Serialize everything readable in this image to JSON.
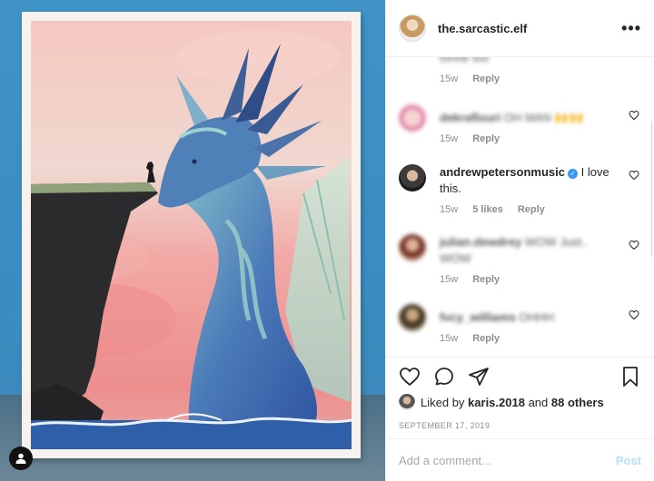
{
  "post": {
    "username": "the.sarcastic.elf",
    "more_label": "•••"
  },
  "comments": [
    {
      "user": "",
      "text": "fonne too",
      "age": "15w",
      "reply": "Reply",
      "blurred": true
    },
    {
      "user": "dekraflouri",
      "text": "OH MAN 🙌🙌",
      "age": "15w",
      "reply": "Reply",
      "blurred": true
    },
    {
      "user": "andrewpetersonmusic",
      "text": "I love this.",
      "age": "15w",
      "likes": "5 likes",
      "reply": "Reply",
      "verified": true
    },
    {
      "user": "julian.dewdrey",
      "text": "WOW Just.. WOW",
      "age": "15w",
      "reply": "Reply",
      "blurred": true
    },
    {
      "user": "fvcy_williams",
      "text": "OHHH",
      "age": "15w",
      "reply": "Reply",
      "blurred": true
    }
  ],
  "likes": {
    "prefix": "Liked by",
    "first_user": "karis.2018",
    "and": "and",
    "others": "88 others"
  },
  "date": "SEPTEMBER 17, 2019",
  "add_comment": {
    "placeholder": "Add a comment...",
    "post_label": "Post"
  },
  "colors": {
    "link_blue": "#3897f0",
    "post_disabled": "#b2dffc",
    "meta_gray": "#8e8e8e"
  },
  "icons": [
    "heart-icon",
    "comment-icon",
    "share-icon",
    "bookmark-icon",
    "user-tag-icon",
    "verified-badge-icon"
  ]
}
